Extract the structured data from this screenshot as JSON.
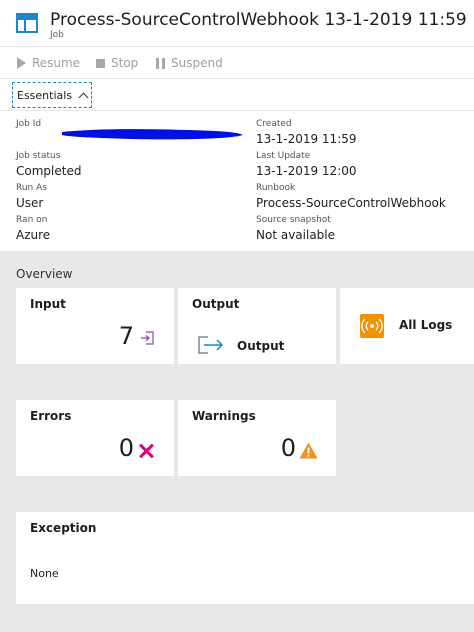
{
  "header": {
    "title": "Process-SourceControlWebhook 13-1-2019 11:59",
    "subtitle": "Job"
  },
  "toolbar": {
    "resume_label": "Resume",
    "stop_label": "Stop",
    "suspend_label": "Suspend"
  },
  "essentials": {
    "toggle_label": "Essentials",
    "left": [
      {
        "label": "Job Id",
        "value": ""
      },
      {
        "label": "Job status",
        "value": "Completed"
      },
      {
        "label": "Run As",
        "value": "User"
      },
      {
        "label": "Ran on",
        "value": "Azure"
      }
    ],
    "right": [
      {
        "label": "Created",
        "value": "13-1-2019 11:59"
      },
      {
        "label": "Last Update",
        "value": "13-1-2019 12:00"
      },
      {
        "label": "Runbook",
        "value": "Process-SourceControlWebhook"
      },
      {
        "label": "Source snapshot",
        "value": "Not available"
      }
    ]
  },
  "overview": {
    "title": "Overview",
    "input": {
      "title": "Input",
      "count": "7"
    },
    "output": {
      "title": "Output",
      "link_label": "Output"
    },
    "all_logs": {
      "label": "All Logs"
    },
    "errors": {
      "title": "Errors",
      "count": "0"
    },
    "warnings": {
      "title": "Warnings",
      "count": "0"
    },
    "exception": {
      "title": "Exception",
      "value": "None"
    }
  },
  "colors": {
    "accent": "#1f86c6",
    "error": "#e2007a",
    "warning": "#f0901e",
    "logs": "#f39200",
    "redaction": "#0010e0"
  }
}
